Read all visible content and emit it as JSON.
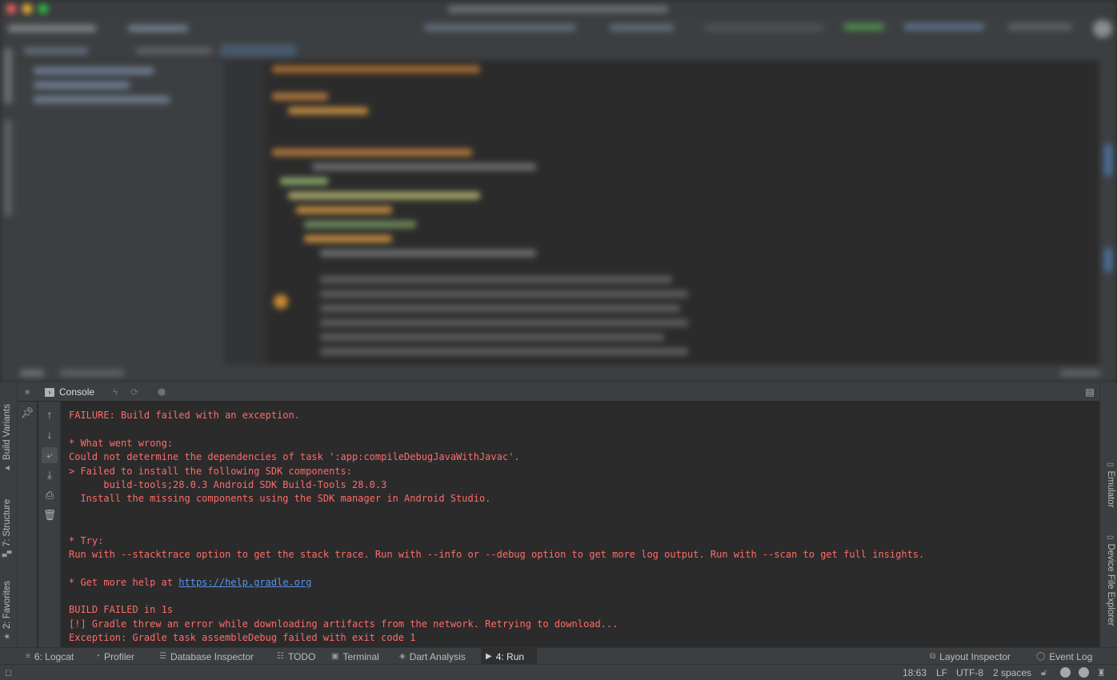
{
  "run_window": {
    "console_tab_label": "Console"
  },
  "console_lines": [
    {
      "text": "FAILURE: Build failed with an exception."
    },
    {
      "text": ""
    },
    {
      "text": "* What went wrong:"
    },
    {
      "text": "Could not determine the dependencies of task ':app:compileDebugJavaWithJavac'."
    },
    {
      "text": "> Failed to install the following SDK components:"
    },
    {
      "text": "      build-tools;28.0.3 Android SDK Build-Tools 28.0.3"
    },
    {
      "text": "  Install the missing components using the SDK manager in Android Studio."
    },
    {
      "text": ""
    },
    {
      "text": ""
    },
    {
      "text": "* Try:"
    },
    {
      "text": "Run with --stacktrace option to get the stack trace. Run with --info or --debug option to get more log output. Run with --scan to get full insights."
    },
    {
      "text": ""
    },
    {
      "text": "* Get more help at ",
      "link": "https://help.gradle.org"
    },
    {
      "text": ""
    },
    {
      "text": "BUILD FAILED in 1s"
    },
    {
      "text": "[!] Gradle threw an error while downloading artifacts from the network. Retrying to download..."
    },
    {
      "text": "Exception: Gradle task assembleDebug failed with exit code 1"
    }
  ],
  "left_side_tabs": {
    "build_variants": "Build Variants",
    "structure": "7: Structure",
    "favorites": "2: Favorites"
  },
  "right_side_tabs": {
    "emulator": "Emulator",
    "device_file_explorer": "Device File Explorer"
  },
  "bottom_tabs": {
    "logcat": "6: Logcat",
    "profiler": "Profiler",
    "database_inspector": "Database Inspector",
    "todo": "TODO",
    "terminal": "Terminal",
    "dart_analysis": "Dart Analysis",
    "run": "4: Run",
    "layout_inspector": "Layout Inspector",
    "event_log": "Event Log"
  },
  "status_bar": {
    "position": "18:63",
    "line_separator": "LF",
    "encoding": "UTF-8",
    "indent": "2 spaces"
  },
  "colors": {
    "error_text": "#ff6b68",
    "link": "#5394ec",
    "console_bg": "#2b2b2b",
    "panel_bg": "#3c3f41"
  }
}
